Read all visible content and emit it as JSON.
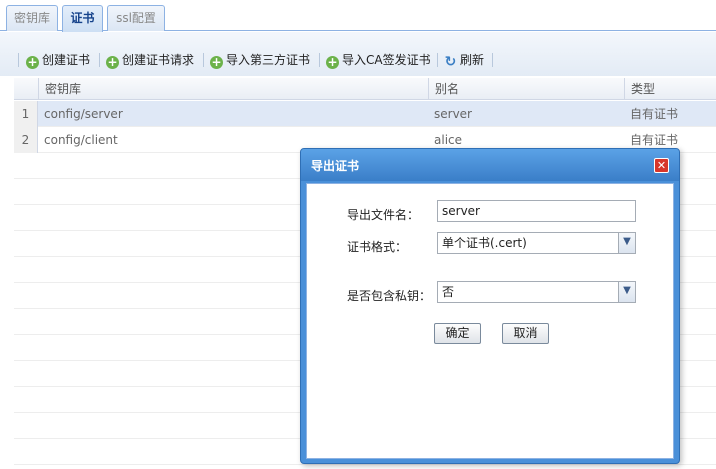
{
  "tabs": [
    {
      "label": "密钥库"
    },
    {
      "label": "证书"
    },
    {
      "label": "ssl配置"
    }
  ],
  "toolbar": {
    "create_cert": "创建证书",
    "create_request": "创建证书请求",
    "import_third": "导入第三方证书",
    "import_ca": "导入CA签发证书",
    "refresh": "刷新"
  },
  "grid": {
    "columns": [
      "密钥库",
      "别名",
      "类型"
    ],
    "rows": [
      {
        "num": "1",
        "keystore": "config/server",
        "alias": "server",
        "type": "自有证书"
      },
      {
        "num": "2",
        "keystore": "config/client",
        "alias": "alice",
        "type": "自有证书"
      }
    ]
  },
  "dialog": {
    "title": "导出证书",
    "filename_label": "导出文件名：",
    "filename_value": "server",
    "format_label": "证书格式：",
    "format_value": "单个证书(.cert)",
    "privkey_label": "是否包含私钥：",
    "privkey_value": "否",
    "ok_label": "确定",
    "cancel_label": "取消"
  },
  "colors": {
    "accent": "#4a90d9",
    "selected_row": "#dfe8f6",
    "tab_border": "#8db2e3"
  }
}
